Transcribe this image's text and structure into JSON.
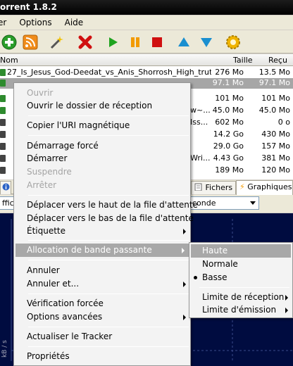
{
  "window": {
    "title": "orrent 1.8.2"
  },
  "menubar": {
    "items": [
      "er",
      "Options",
      "Aide"
    ]
  },
  "list": {
    "headers": {
      "name": "Nom",
      "size": "Taille",
      "received": "Reçu"
    },
    "rows": [
      {
        "name": "27_Is_Jesus_God-Deedat_vs_Anis_Shorrosh_High_truth...",
        "size": "276 Mo",
        "received": "13.5 Mo",
        "status_color": "#2e8b2e"
      },
      {
        "name": "",
        "size": "97.1 Mo",
        "received": "97.1 Mo",
        "status_color": "#2e8b2e"
      },
      {
        "name": "",
        "size": "101 Mo",
        "received": "101 Mo",
        "status_color": "#2e8b2e"
      },
      {
        "name": "w~...",
        "size": "45.0 Mo",
        "received": "45.0 Mo",
        "status_color": "#2e8b2e"
      },
      {
        "name": "Iss...",
        "size": "602 Mo",
        "received": "0 o",
        "status_color": "#444444"
      },
      {
        "name": "",
        "size": "14.2 Go",
        "received": "430 Mo",
        "status_color": "#444444"
      },
      {
        "name": "",
        "size": "29.0 Go",
        "received": "157 Mo",
        "status_color": "#444444"
      },
      {
        "name": "Wri...",
        "size": "4.43 Go",
        "received": "381 Mo",
        "status_color": "#444444"
      },
      {
        "name": "",
        "size": "189 Mo",
        "received": "120 Mo",
        "status_color": "#444444"
      }
    ]
  },
  "tabs": {
    "files": "Fichers",
    "graphs": "Graphiques"
  },
  "options": {
    "left_combo": "ffic",
    "right_combo": "conde"
  },
  "graph": {
    "ylabel": "kB / s"
  },
  "context_menu": {
    "open": "Ouvrir",
    "open_folder": "Ouvrir le dossier de réception",
    "copy_magnet": "Copier l'URI magnétique",
    "force_start": "Démarrage forcé",
    "start": "Démarrer",
    "pause": "Suspendre",
    "stop": "Arrêter",
    "move_top": "Déplacer vers le haut de la file d'attente",
    "move_bottom": "Déplacer vers le bas de la file d'attente",
    "label": "Étiquette",
    "bandwidth": "Allocation de bande passante",
    "cancel": "Annuler",
    "cancel_and": "Annuler et...",
    "force_check": "Vérification forcée",
    "advanced": "Options avancées",
    "update_tracker": "Actualiser le Tracker",
    "properties": "Propriétés"
  },
  "submenu": {
    "high": "Haute",
    "normal": "Normale",
    "low": "Basse",
    "selected": "Basse",
    "recv_limit": "Limite de réception",
    "send_limit": "Limite d'émission"
  },
  "colors": {
    "highlight": "#a8a8a8",
    "graph_bg": "#000c40"
  }
}
